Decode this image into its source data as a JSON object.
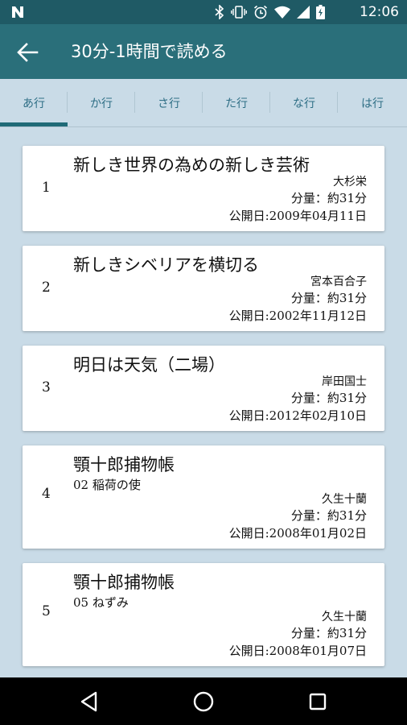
{
  "status_bar": {
    "time": "12:06",
    "icons": [
      "bluetooth-icon",
      "vibrate-icon",
      "alarm-icon",
      "wifi-icon",
      "signal-icon",
      "battery-icon"
    ]
  },
  "app_bar": {
    "title": "30分-1時間で読める",
    "back_icon": "arrow-left-icon"
  },
  "tabs": [
    {
      "label": "あ行",
      "active": true
    },
    {
      "label": "か行",
      "active": false
    },
    {
      "label": "さ行",
      "active": false
    },
    {
      "label": "た行",
      "active": false
    },
    {
      "label": "な行",
      "active": false
    },
    {
      "label": "は行",
      "active": false
    }
  ],
  "works": [
    {
      "index": "1",
      "title": "新しき世界の為めの新しき芸術",
      "subtitle": "",
      "author": "大杉栄",
      "volume": "分量：約31分",
      "published": "公開日:2009年04月11日"
    },
    {
      "index": "2",
      "title": "新しきシベリアを横切る",
      "subtitle": "",
      "author": "宮本百合子",
      "volume": "分量：約31分",
      "published": "公開日:2002年11月12日"
    },
    {
      "index": "3",
      "title": "明日は天気（二場）",
      "subtitle": "",
      "author": "岸田国士",
      "volume": "分量：約31分",
      "published": "公開日:2012年02月10日"
    },
    {
      "index": "4",
      "title": "顎十郎捕物帳",
      "subtitle": "02 稲荷の使",
      "author": "久生十蘭",
      "volume": "分量：約31分",
      "published": "公開日:2008年01月02日"
    },
    {
      "index": "5",
      "title": "顎十郎捕物帳",
      "subtitle": "05 ねずみ",
      "author": "久生十蘭",
      "volume": "分量：約31分",
      "published": "公開日:2008年01月07日"
    }
  ],
  "nav_bar": {
    "icons": [
      "back-triangle-icon",
      "home-circle-icon",
      "recents-square-icon"
    ]
  },
  "colors": {
    "status_bar": "#1f5a65",
    "app_bar": "#2a6f7a",
    "background": "#c9dbe7",
    "tab_text": "#2f6f86",
    "tab_indicator": "#1f6a77"
  }
}
